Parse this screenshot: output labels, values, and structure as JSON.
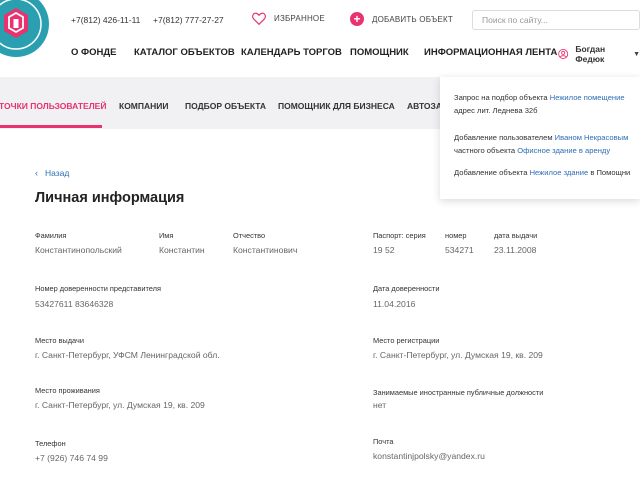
{
  "header": {
    "phone1": "+7(812) 426-11-11",
    "phone2": "+7(812) 777-27-27",
    "favorites_label": "ИЗБРАННОЕ",
    "add_object_label": "ДОБАВИТЬ ОБЪЕКТ",
    "search_placeholder": "Поиск по сайту...",
    "user_name": "Богдан Федюк"
  },
  "main_nav": [
    "О ФОНДЕ",
    "КАТАЛОГ ОБЪЕКТОВ",
    "КАЛЕНДАРЬ ТОРГОВ",
    "ПОМОЩНИК",
    "ИНФОРМАЦИОННАЯ ЛЕНТА"
  ],
  "sub_nav": [
    "ТОЧКИ ПОЛЬЗОВАТЕЛЕЙ",
    "КОМПАНИИ",
    "ПОДБОР ОБЪЕКТА",
    "ПОМОЩНИК ДЛЯ БИЗНЕСА",
    "АВТОЗА"
  ],
  "notifications": [
    {
      "line1_text": "Запрос на подбор объекта ",
      "line1_link": "Нежилое помещение",
      "line2": "адрес лит. Леднева 32б"
    },
    {
      "line1_text": "Добавление пользователем ",
      "line1_link": "Иваном Некрасовым",
      "line2_text": "частного объекта ",
      "line2_link": "Офисное здание в аренду"
    },
    {
      "line1_text": "Добавление объекта ",
      "line1_link": "Нежилое здание",
      "line1_after": " в Помощни"
    }
  ],
  "content": {
    "back_label": "Назад",
    "title": "Личная информация",
    "fields": {
      "surname_label": "Фамилия",
      "surname": "Константинопольский",
      "name_label": "Имя",
      "name": "Константин",
      "patronymic_label": "Отчество",
      "patronymic": "Константинович",
      "passport_series_label": "Паспорт: серия",
      "passport_series": "19 52",
      "passport_number_label": "номер",
      "passport_number": "534271",
      "issue_date_label": "дата выдачи",
      "issue_date": "23.11.2008",
      "poa_number_label": "Номер доверенности представителя",
      "poa_number": "53427611 83646328",
      "poa_date_label": "Дата доверенности",
      "poa_date": "11.04.2016",
      "issue_place_label": "Место выдачи",
      "issue_place": "г. Санкт-Петербург, УФСМ Ленинградской обл.",
      "registration_label": "Место регистрации",
      "registration": "г. Санкт-Петербург, ул. Думская 19, кв. 209",
      "residence_label": "Место проживания",
      "residence": "г. Санкт-Петербург, ул. Думская 19, кв. 209",
      "public_positions_label": "Занимаемые иностранные публичные должности",
      "public_positions": "нет",
      "phone_label": "Телефон",
      "phone": "+7 (926) 746 74 99",
      "email_label": "Почта",
      "email": "konstantinjpolsky@yandex.ru"
    }
  },
  "colors": {
    "accent": "#e8336f",
    "link": "#2f6eb5",
    "logo": "#2a9fb0",
    "subnav_bg": "#f1f1f3"
  }
}
